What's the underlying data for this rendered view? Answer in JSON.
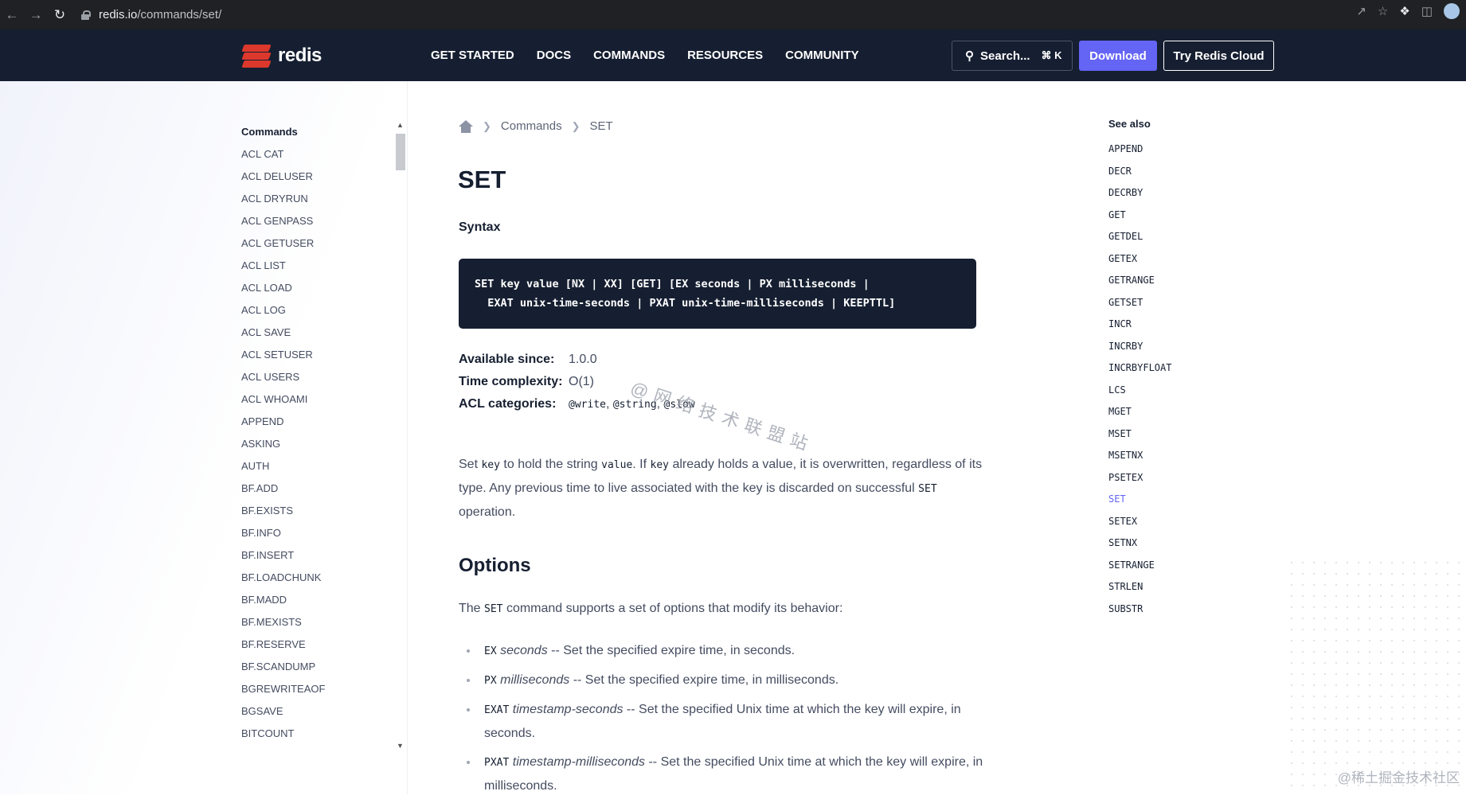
{
  "browser": {
    "url_host": "redis.io",
    "url_path": "/commands/set/"
  },
  "header": {
    "logo_text": "redis",
    "nav": [
      "GET STARTED",
      "DOCS",
      "COMMANDS",
      "RESOURCES",
      "COMMUNITY"
    ],
    "search_label": "Search...",
    "search_shortcut": "⌘ K",
    "download_label": "Download",
    "cloud_label": "Try Redis Cloud"
  },
  "sidebar": {
    "heading": "Commands",
    "items": [
      "ACL CAT",
      "ACL DELUSER",
      "ACL DRYRUN",
      "ACL GENPASS",
      "ACL GETUSER",
      "ACL LIST",
      "ACL LOAD",
      "ACL LOG",
      "ACL SAVE",
      "ACL SETUSER",
      "ACL USERS",
      "ACL WHOAMI",
      "APPEND",
      "ASKING",
      "AUTH",
      "BF.ADD",
      "BF.EXISTS",
      "BF.INFO",
      "BF.INSERT",
      "BF.LOADCHUNK",
      "BF.MADD",
      "BF.MEXISTS",
      "BF.RESERVE",
      "BF.SCANDUMP",
      "BGREWRITEAOF",
      "BGSAVE",
      "BITCOUNT"
    ]
  },
  "breadcrumb": {
    "commands": "Commands",
    "current": "SET"
  },
  "page": {
    "title": "SET",
    "syntax_label": "Syntax",
    "syntax_line1": "SET key value [NX | XX] [GET] [EX seconds | PX milliseconds |",
    "syntax_line2": "  EXAT unix-time-seconds | PXAT unix-time-milliseconds | KEEPTTL]",
    "available_since_label": "Available since:",
    "available_since": "1.0.0",
    "time_complexity_label": "Time complexity:",
    "time_complexity": "O(1)",
    "acl_label": "ACL categories:",
    "acl_values": [
      "@write",
      "@string",
      "@slow"
    ],
    "desc_part1": "Set ",
    "desc_code1": "key",
    "desc_part2": " to hold the string ",
    "desc_code2": "value",
    "desc_part3": ". If ",
    "desc_code3": "key",
    "desc_part4": " already holds a value, it is overwritten, regardless of its type. Any previous time to live associated with the key is discarded on successful ",
    "desc_code4": "SET",
    "desc_part5": " operation.",
    "options_heading": "Options",
    "options_intro_pre": "The ",
    "options_intro_code": "SET",
    "options_intro_post": " command supports a set of options that modify its behavior:",
    "options": [
      {
        "code": "EX",
        "arg": "seconds",
        "text": " -- Set the specified expire time, in seconds."
      },
      {
        "code": "PX",
        "arg": "milliseconds",
        "text": " -- Set the specified expire time, in milliseconds."
      },
      {
        "code": "EXAT",
        "arg": "timestamp-seconds",
        "text": " -- Set the specified Unix time at which the key will expire, in seconds."
      },
      {
        "code": "PXAT",
        "arg": "timestamp-milliseconds",
        "text": " -- Set the specified Unix time at which the key will expire, in milliseconds."
      }
    ]
  },
  "see_also": {
    "title": "See also",
    "items": [
      "APPEND",
      "DECR",
      "DECRBY",
      "GET",
      "GETDEL",
      "GETEX",
      "GETRANGE",
      "GETSET",
      "INCR",
      "INCRBY",
      "INCRBYFLOAT",
      "LCS",
      "MGET",
      "MSET",
      "MSETNX",
      "PSETEX",
      "SET",
      "SETEX",
      "SETNX",
      "SETRANGE",
      "STRLEN",
      "SUBSTR"
    ],
    "current": "SET"
  },
  "watermark": "@网络技术联盟站",
  "corner_mark": "@稀土掘金技术社区",
  "colors": {
    "header_bg": "#161f31",
    "accent": "#6464f5",
    "redis_red": "#dc382c"
  }
}
